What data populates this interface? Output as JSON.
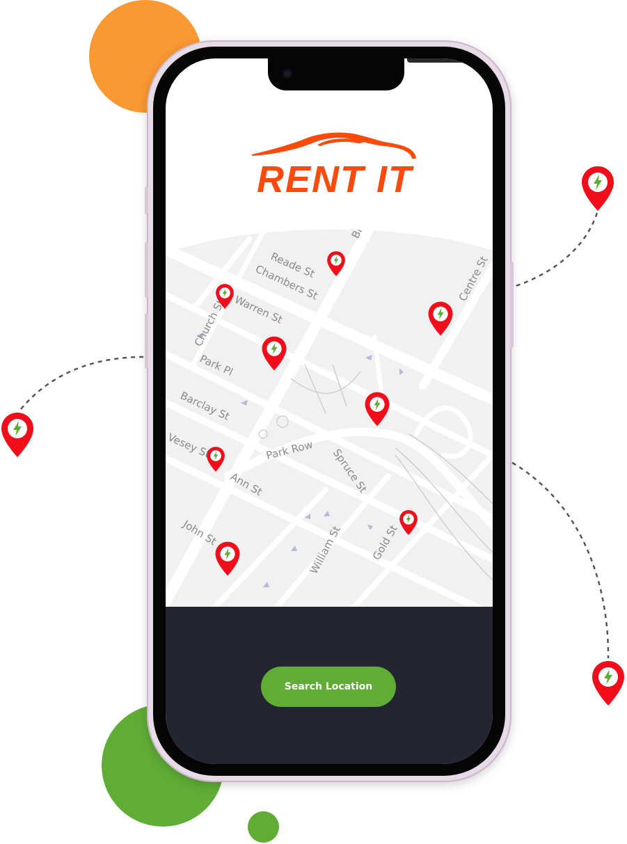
{
  "app": {
    "name": "RENT IT",
    "brand_color": "#ff4a0c",
    "accent_color": "#5fad36"
  },
  "decor": {
    "orange_color": "#fa9832",
    "green_color": "#5fad36"
  },
  "map": {
    "street_labels": [
      "Reade St",
      "Broadway",
      "Chambers St",
      "Warren St",
      "Centre St",
      "Church St",
      "Park Pl",
      "Barclay St",
      "Park Row",
      "Spruce St",
      "Vesey St",
      "Ann St",
      "John St",
      "William St",
      "Gold St"
    ],
    "pin_icon": "charging-bolt-icon",
    "pin_color": "#f20d1a"
  },
  "bottom_panel": {
    "search_button_label": "Search Location"
  }
}
